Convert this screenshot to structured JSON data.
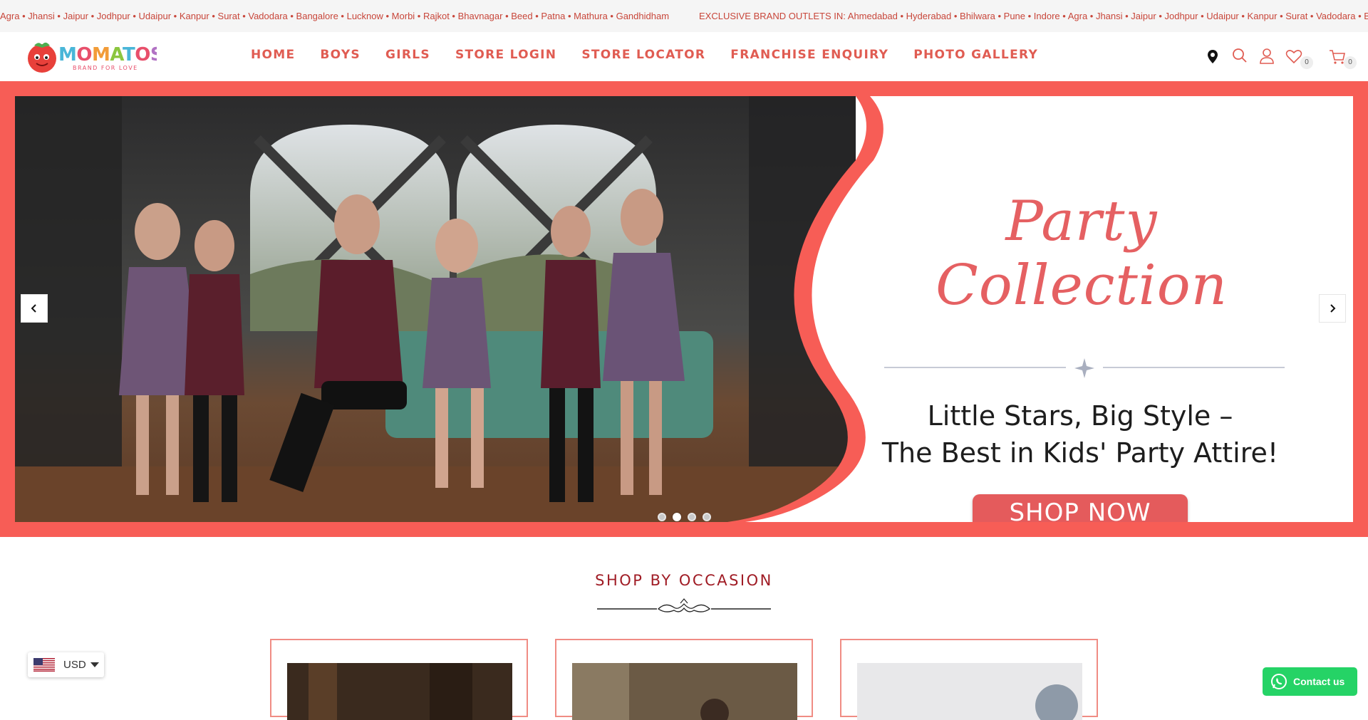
{
  "ticker": {
    "text_left": "Agra • Jhansi • Jaipur • Jodhpur • Udaipur • Kanpur • Surat • Vadodara • Bangalore • Lucknow • Morbi • Rajkot • Bhavnagar • Beed • Patna • Mathura • Gandhidham",
    "text_right": "EXCLUSIVE BRAND OUTLETS IN: Ahmedabad • Hyderabad • Bhilwara • Pune • Indore • Agra • Jhansi • Jaipur • Jodhpur • Udaipur • Kanpur • Surat • Vadodara • B"
  },
  "brand": {
    "logo_text": "MOMATOS",
    "tagline": "BRAND FOR LOVE",
    "icon": "tomato-mascot-icon"
  },
  "nav": {
    "items": [
      "HOME",
      "BOYS",
      "GIRLS",
      "STORE LOGIN",
      "STORE LOCATOR",
      "FRANCHISE ENQUIRY",
      "PHOTO GALLERY"
    ]
  },
  "header_icons": {
    "location_icon": "location-pin-icon",
    "search_icon": "search-icon",
    "account_icon": "user-icon",
    "wishlist_icon": "heart-icon",
    "wishlist_count": "0",
    "cart_icon": "cart-icon",
    "cart_count": "0"
  },
  "hero": {
    "title": "Party Collection",
    "tagline_line1": "Little Stars, Big Style –",
    "tagline_line2": "The Best in Kids' Party Attire!",
    "cta": "SHOP NOW",
    "prev_icon": "chevron-left-icon",
    "next_icon": "chevron-right-icon",
    "slides": 4,
    "active_slide": 2
  },
  "section": {
    "title": "SHOP BY OCCASION"
  },
  "currency": {
    "code": "USD",
    "flag": "us-flag-icon"
  },
  "whatsapp": {
    "label": "Contact us",
    "icon": "whatsapp-icon"
  },
  "colors": {
    "brand_red": "#f75d56",
    "nav_text": "#e05c52",
    "section_title": "#a01c25",
    "whatsapp_green": "#25d366"
  }
}
